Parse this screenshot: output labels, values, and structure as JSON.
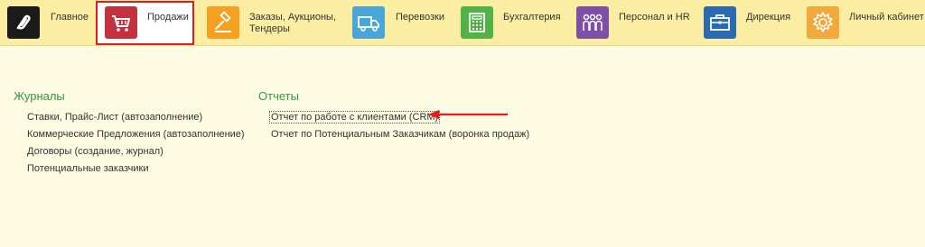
{
  "nav": {
    "items": [
      {
        "label": "Главное",
        "icon": "logo-icon",
        "color": "#1a1a1a"
      },
      {
        "label": "Продажи",
        "icon": "cart-icon",
        "color": "#c3303e"
      },
      {
        "label": "Заказы,  Аукционы, Тендеры",
        "icon": "gavel-icon",
        "color": "#f5a01e"
      },
      {
        "label": "Перевозки",
        "icon": "truck-icon",
        "color": "#4aa6d8"
      },
      {
        "label": "Бухгалтерия",
        "icon": "calculator-icon",
        "color": "#52b248"
      },
      {
        "label": "Персонал и HR",
        "icon": "people-icon",
        "color": "#7d4fa5"
      },
      {
        "label": "Дирекция",
        "icon": "briefcase-icon",
        "color": "#2a6ab3"
      },
      {
        "label": "Личный кабинет",
        "icon": "gear-icon",
        "color": "#f2a83a"
      }
    ],
    "active": "Продажи",
    "tenders_line1": "Заказы,  Аукционы,",
    "tenders_line2": "Тендеры"
  },
  "journals": {
    "title": "Журналы",
    "items": [
      "Ставки, Прайс-Лист (автозаполнение)",
      "Коммерческие Предложения (автозаполнение)",
      "Договоры (создание, журнал)",
      "Потенциальные заказчики"
    ]
  },
  "reports": {
    "title": "Отчеты",
    "items": [
      "Отчет по работе с клиентами (CRM)",
      "Отчет по Потенциальным Заказчикам (воронка продаж)"
    ],
    "highlighted_index": 0
  },
  "annotation": {
    "arrow_color": "#e51c1c"
  }
}
